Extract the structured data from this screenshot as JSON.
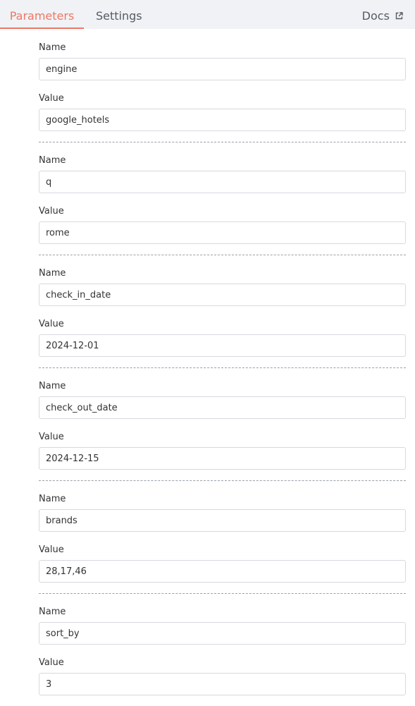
{
  "tabs": {
    "parameters": "Parameters",
    "settings": "Settings"
  },
  "docs_label": "Docs",
  "docs_icon": "external-link-icon",
  "accent_color": "#ee7766",
  "name_label": "Name",
  "value_label": "Value",
  "params": [
    {
      "name": "engine",
      "value": "google_hotels"
    },
    {
      "name": "q",
      "value": "rome"
    },
    {
      "name": "check_in_date",
      "value": "2024-12-01"
    },
    {
      "name": "check_out_date",
      "value": "2024-12-15"
    },
    {
      "name": "brands",
      "value": "28,17,46"
    },
    {
      "name": "sort_by",
      "value": "3"
    }
  ]
}
